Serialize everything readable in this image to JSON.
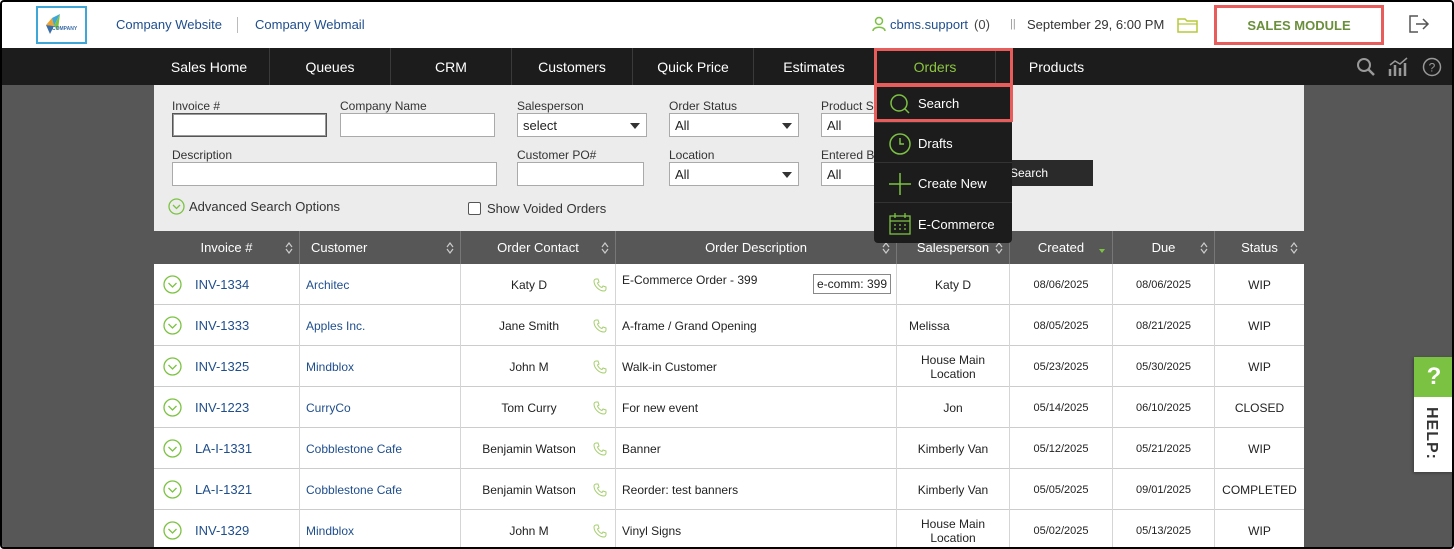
{
  "header": {
    "logo_text": "COMPANY",
    "links": [
      "Company Website",
      "Company Webmail"
    ],
    "user_name": "cbms.support",
    "user_count": "(0)",
    "separator": "||",
    "datetime": "September 29, 6:00 PM",
    "module_label": "SALES MODULE"
  },
  "nav": {
    "items": [
      "Sales Home",
      "Queues",
      "CRM",
      "Customers",
      "Quick Price",
      "Estimates",
      "Orders",
      "Products"
    ],
    "active": "Orders"
  },
  "orders_menu": {
    "items": [
      "Search",
      "Drafts",
      "Create New",
      "E-Commerce"
    ]
  },
  "search": {
    "invoice_label": "Invoice #",
    "invoice_value": "",
    "company_label": "Company Name",
    "company_value": "",
    "salesperson_label": "Salesperson",
    "salesperson_value": "select",
    "order_status_label": "Order Status",
    "order_status_value": "All",
    "product_label": "Product S",
    "product_value": "All",
    "description_label": "Description",
    "description_value": "",
    "customer_po_label": "Customer PO#",
    "customer_po_value": "",
    "location_label": "Location",
    "location_value": "All",
    "entered_by_label": "Entered By",
    "entered_by_value": "All",
    "advanced_label": "Advanced Search Options",
    "voided_label": "Show Voided Orders",
    "button_label": "Search"
  },
  "table": {
    "columns": [
      "Invoice #",
      "Customer",
      "Order Contact",
      "Order Description",
      "Salesperson",
      "Created",
      "Due",
      "Status"
    ],
    "rows": [
      {
        "invoice": "INV-1334",
        "customer": "Architec",
        "contact": "Katy D",
        "description": "E-Commerce Order - 399",
        "badge": "e-comm: 399",
        "salesperson": "Katy D",
        "created": "08/06/2025",
        "due": "08/06/2025",
        "status": "WIP"
      },
      {
        "invoice": "INV-1333",
        "customer": "Apples Inc.",
        "contact": "Jane Smith",
        "description": "A-frame / Grand Opening",
        "badge": "",
        "salesperson": "Melissa",
        "created": "08/05/2025",
        "due": "08/21/2025",
        "status": "WIP"
      },
      {
        "invoice": "INV-1325",
        "customer": "Mindblox",
        "contact": "John M",
        "description": "Walk-in Customer",
        "badge": "",
        "salesperson": "House Main Location",
        "created": "05/23/2025",
        "due": "05/30/2025",
        "status": "WIP"
      },
      {
        "invoice": "INV-1223",
        "customer": "CurryCo",
        "contact": "Tom Curry",
        "description": "For new event",
        "badge": "",
        "salesperson": "Jon",
        "created": "05/14/2025",
        "due": "06/10/2025",
        "status": "CLOSED"
      },
      {
        "invoice": "LA-I-1331",
        "customer": "Cobblestone Cafe",
        "contact": "Benjamin Watson",
        "description": "Banner",
        "badge": "",
        "salesperson": "Kimberly Van",
        "created": "05/12/2025",
        "due": "05/21/2025",
        "status": "WIP"
      },
      {
        "invoice": "LA-I-1321",
        "customer": "Cobblestone Cafe",
        "contact": "Benjamin Watson",
        "description": "Reorder: test banners",
        "badge": "",
        "salesperson": "Kimberly Van",
        "created": "05/05/2025",
        "due": "09/01/2025",
        "status": "COMPLETED"
      },
      {
        "invoice": "INV-1329",
        "customer": "Mindblox",
        "contact": "John M",
        "description": "Vinyl Signs",
        "badge": "",
        "salesperson": "House Main Location",
        "created": "05/02/2025",
        "due": "05/13/2025",
        "status": "WIP"
      }
    ]
  },
  "help": {
    "symbol": "?",
    "label": "HELP:"
  },
  "colors": {
    "accent_green": "#8cc63f",
    "highlight_red": "#e85c5c",
    "link_blue": "#1f4e8c",
    "nav_bg": "#1c1c1c"
  }
}
